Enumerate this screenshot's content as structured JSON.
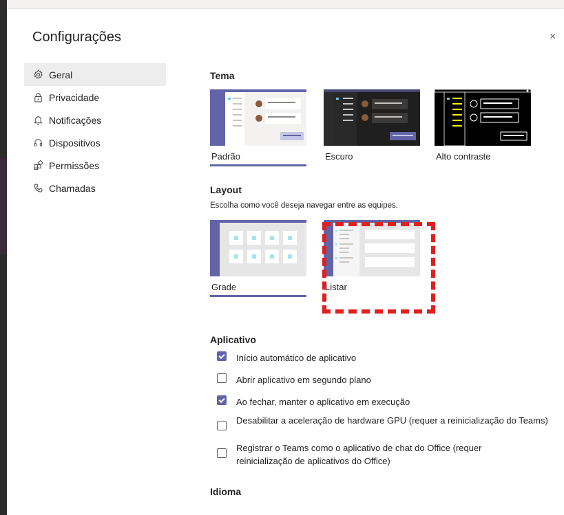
{
  "dialog": {
    "title": "Configurações",
    "close_symbol": "×"
  },
  "nav": {
    "items": [
      {
        "label": "Geral",
        "icon": "gear-icon",
        "active": true
      },
      {
        "label": "Privacidade",
        "icon": "lock-icon",
        "active": false
      },
      {
        "label": "Notificações",
        "icon": "bell-icon",
        "active": false
      },
      {
        "label": "Dispositivos",
        "icon": "headset-icon",
        "active": false
      },
      {
        "label": "Permissões",
        "icon": "apps-icon",
        "active": false
      },
      {
        "label": "Chamadas",
        "icon": "phone-icon",
        "active": false
      }
    ]
  },
  "theme": {
    "title": "Tema",
    "options": [
      {
        "label": "Padrão",
        "selected": true
      },
      {
        "label": "Escuro",
        "selected": false
      },
      {
        "label": "Alto contraste",
        "selected": false
      }
    ]
  },
  "layout": {
    "title": "Layout",
    "description": "Escolha como você deseja navegar entre as equipes.",
    "options": [
      {
        "label": "Grade",
        "selected": true
      },
      {
        "label": "Listar",
        "selected": false,
        "highlighted": true
      }
    ]
  },
  "app": {
    "title": "Aplicativo",
    "options": [
      {
        "label": "Início automático de aplicativo",
        "checked": true
      },
      {
        "label": "Abrir aplicativo em segundo plano",
        "checked": false
      },
      {
        "label": "Ao fechar, manter o aplicativo em execução",
        "checked": true
      },
      {
        "label": "Desabilitar a aceleração de hardware GPU (requer a reinicialização do Teams)",
        "checked": false
      },
      {
        "label": "Registrar o Teams como o aplicativo de chat do Office (requer reinicialização de aplicativos do Office)",
        "checked": false
      }
    ]
  },
  "language": {
    "title": "Idioma"
  },
  "colors": {
    "accent": "#6264a7",
    "highlight": "#e02020"
  }
}
